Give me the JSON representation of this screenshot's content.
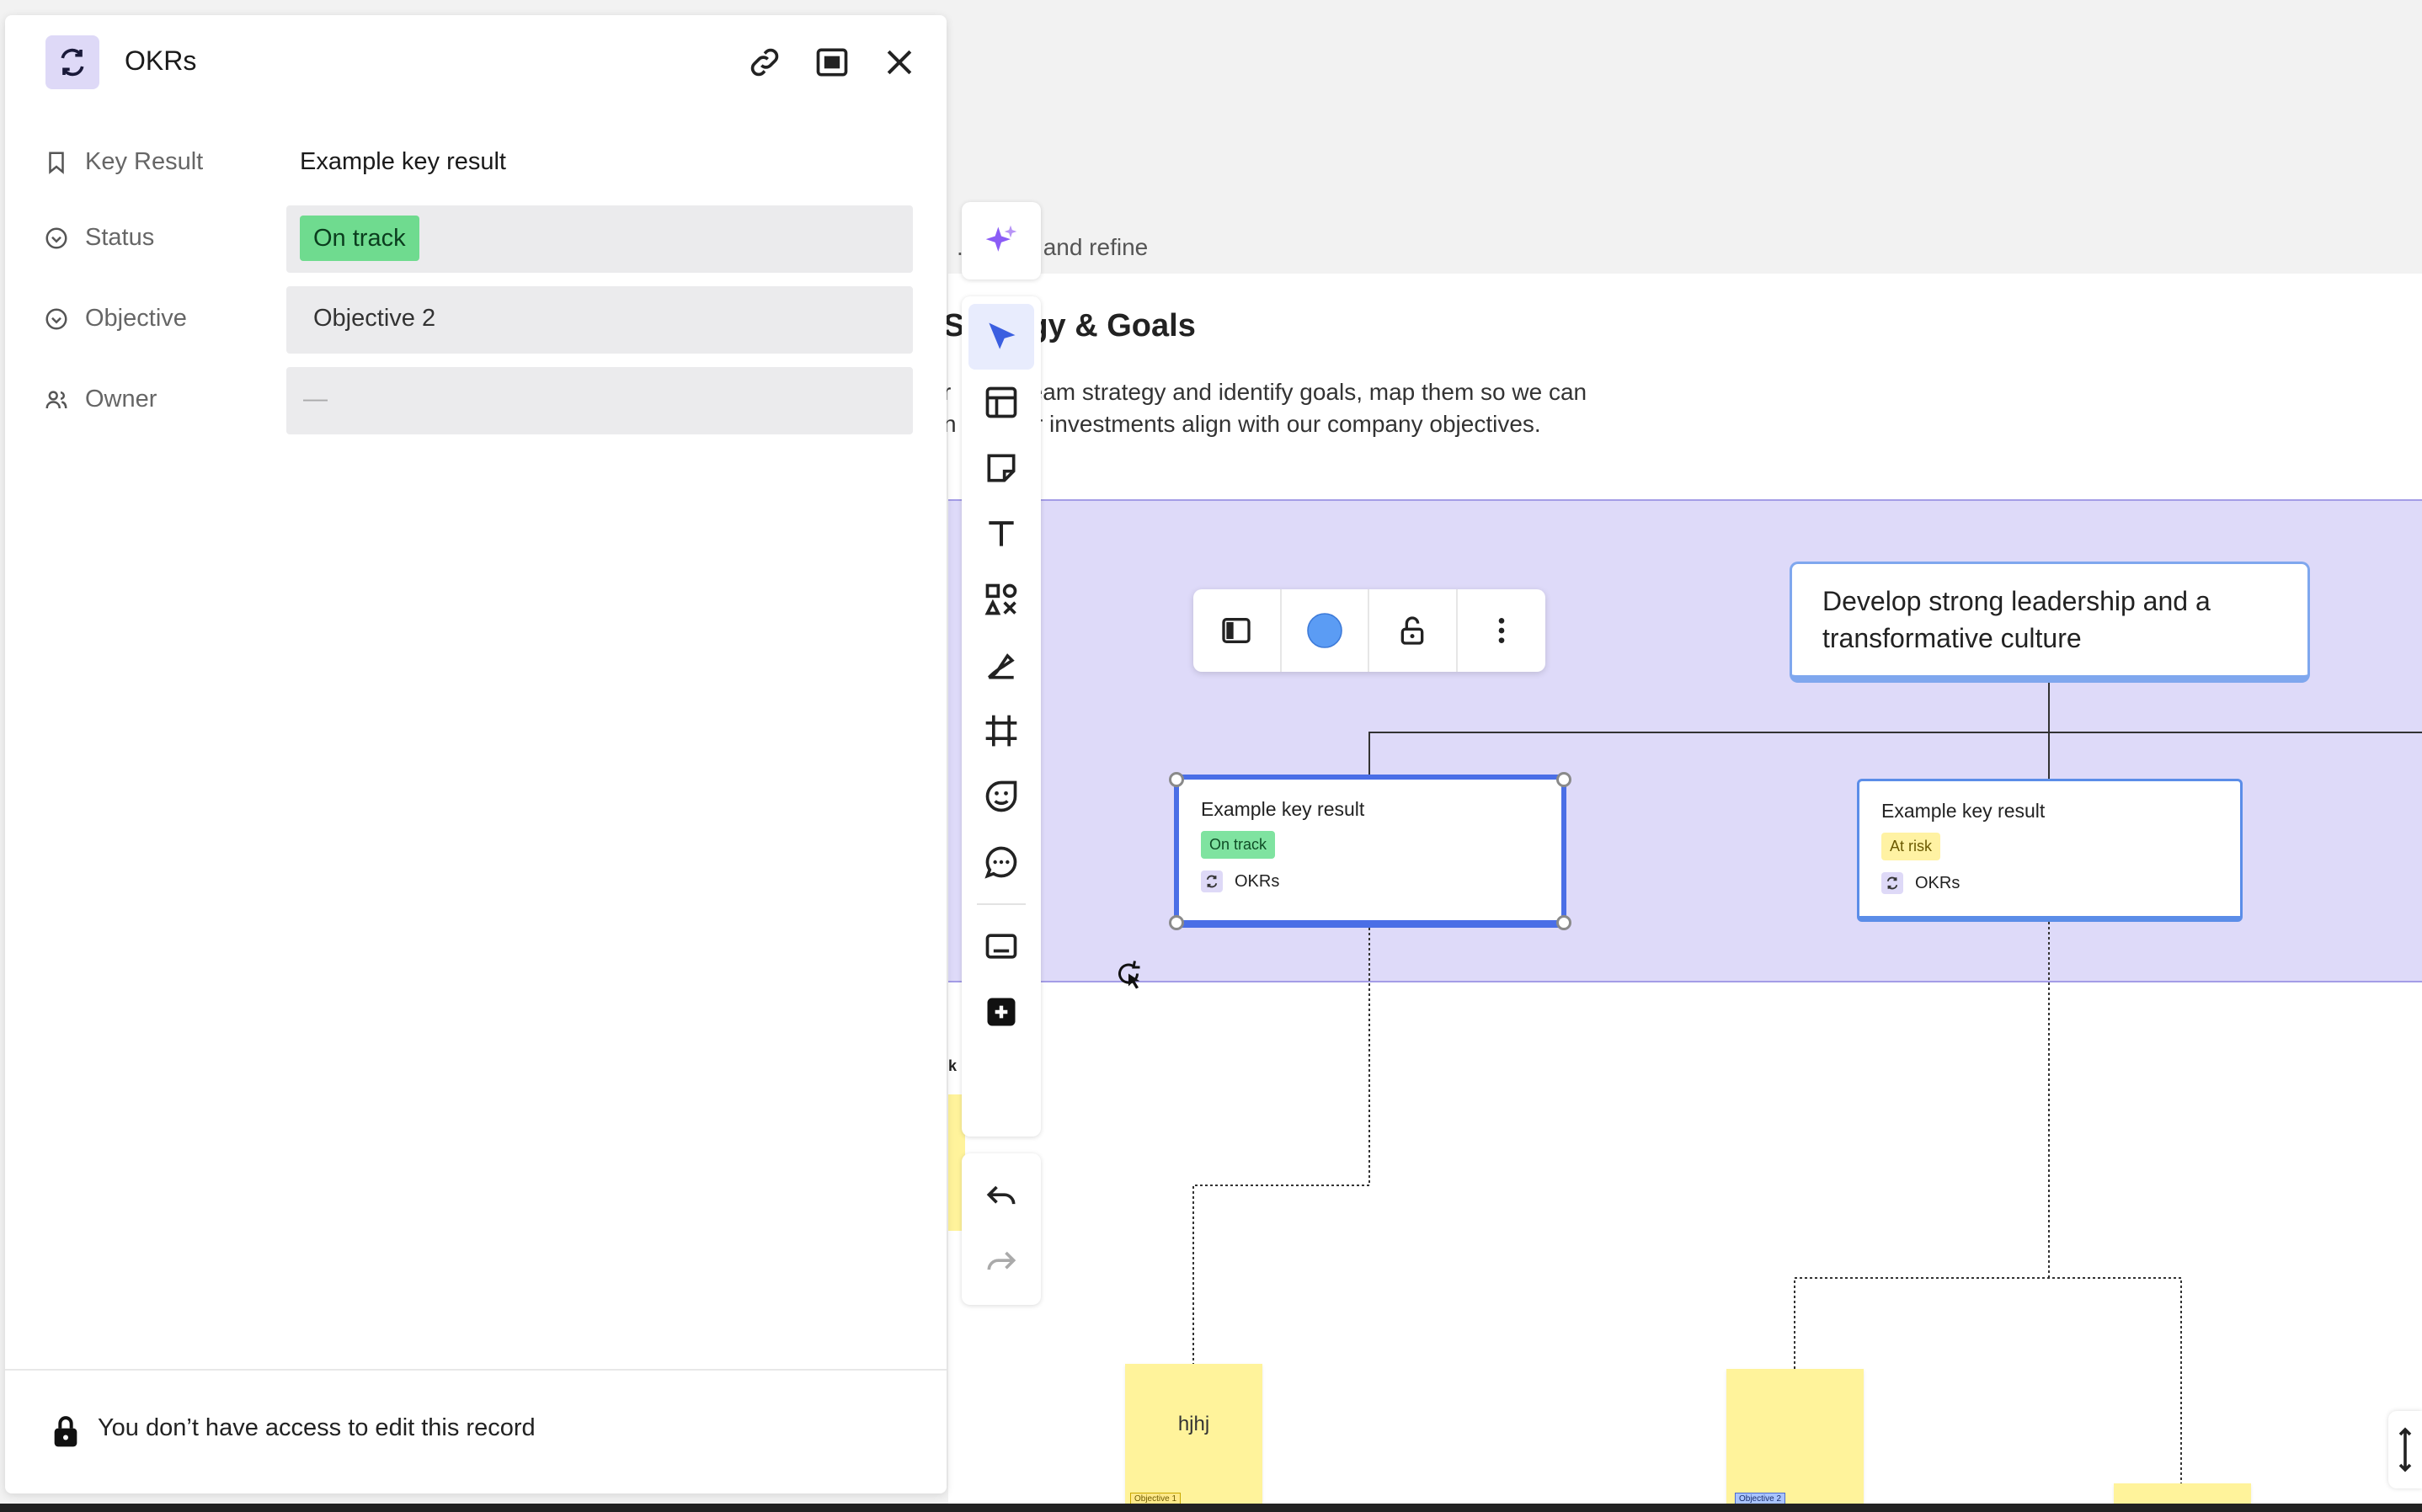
{
  "panel": {
    "title": "OKRs",
    "fields": {
      "key_result": {
        "label": "Key Result",
        "value": "Example key result"
      },
      "status": {
        "label": "Status",
        "value": "On track"
      },
      "objective": {
        "label": "Objective",
        "value": "Objective 2"
      },
      "owner": {
        "label": "Owner",
        "value": "—"
      }
    },
    "footer": {
      "message": "You don’t have access to edit this record"
    }
  },
  "board": {
    "frame_title": ". F      o and refine",
    "section_heading": "St      gy & Goals",
    "section_desc_line1": "r        stream strategy and identify goals, map them so we can",
    "section_desc_line2": "n        our investments align with our company objectives.",
    "objective_card": {
      "text": "Develop strong leadership and a transformative culture"
    },
    "key_results": [
      {
        "title": "Example key result",
        "status": "On track",
        "source": "OKRs"
      },
      {
        "title": "Example key result",
        "status": "At risk",
        "source": "OKRs"
      }
    ],
    "stickies": [
      {
        "text": "hjhj",
        "tag": "Objective 1"
      },
      {
        "text": "",
        "tag": "Objective 2"
      }
    ],
    "partial_letter": "k",
    "context_toolbar": {
      "accent_color": "#5b9cf4"
    }
  },
  "toolbar": {
    "tools": [
      "ai-sparkle",
      "select",
      "templates",
      "sticky-note",
      "text",
      "shapes",
      "pen",
      "frame",
      "sticker",
      "comment",
      "embed",
      "more"
    ],
    "history": [
      "undo",
      "redo"
    ]
  },
  "colors": {
    "lane": "#dedaf9",
    "status_on_track": "#6fdb8f",
    "status_at_risk": "#fff2a3",
    "selection": "#4a6ee6",
    "sticky": "#fff39b"
  }
}
